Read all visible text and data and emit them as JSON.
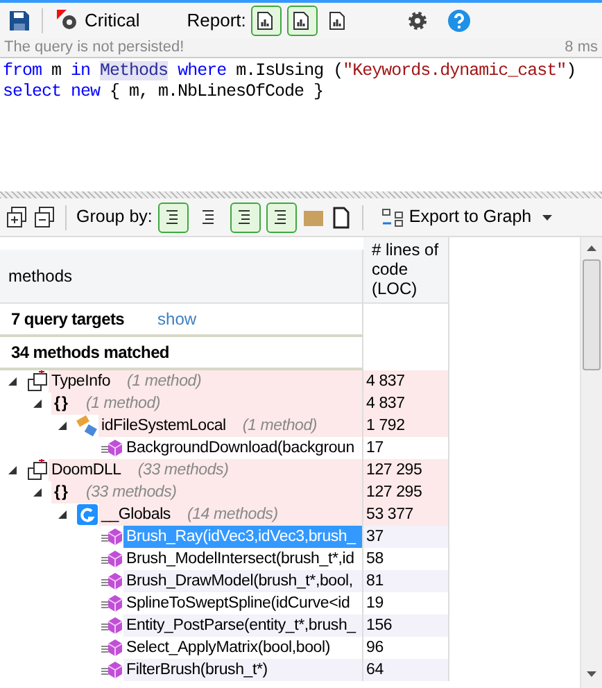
{
  "toolbar": {
    "critical_label": "Critical",
    "report_label": "Report:",
    "report_buttons": [
      {
        "selected": true
      },
      {
        "selected": true
      },
      {
        "selected": false
      }
    ]
  },
  "status": {
    "message": "The query is not persisted!",
    "time": "8 ms"
  },
  "query": [
    [
      {
        "kind": "keyword",
        "text": "from"
      },
      {
        "kind": "plain",
        "text": " m "
      },
      {
        "kind": "keyword",
        "text": "in "
      },
      {
        "kind": "highlight",
        "text": "Methods"
      },
      {
        "kind": "keyword",
        "text": " where"
      },
      {
        "kind": "plain",
        "text": " m.IsUsing ("
      },
      {
        "kind": "string",
        "text": "\"Keywords.dynamic_cast\""
      },
      {
        "kind": "plain",
        "text": ")"
      }
    ],
    [
      {
        "kind": "keyword",
        "text": "select new"
      },
      {
        "kind": "plain",
        "text": " { m, m.NbLinesOfCode }"
      }
    ]
  ],
  "results_toolbar": {
    "group_by_label": "Group by:",
    "group_buttons": [
      {
        "selected": true
      },
      {
        "selected": false
      },
      {
        "selected": true
      },
      {
        "selected": true
      }
    ],
    "export_label": "Export to Graph"
  },
  "table": {
    "columns": [
      "methods",
      "# lines of code (LOC)"
    ],
    "summary": [
      {
        "text": "7 query targets",
        "link": "show"
      },
      {
        "text": "34 methods matched"
      }
    ],
    "tree": [
      {
        "kind": "assembly",
        "name": "TypeInfo",
        "count": "(1 method)",
        "loc": "4 837",
        "expanded": true,
        "selected": false,
        "children": [
          {
            "kind": "namespace",
            "name": "{}",
            "count": "(1 method)",
            "loc": "4 837",
            "expanded": true,
            "selected": false,
            "children": [
              {
                "kind": "type",
                "name": "idFileSystemLocal",
                "count": "(1 method)",
                "loc": "1 792",
                "expanded": true,
                "selected": false,
                "children": [
                  {
                    "kind": "method",
                    "name": "BackgroundDownload(backgroun",
                    "loc": "17",
                    "selected": false
                  }
                ]
              }
            ]
          }
        ]
      },
      {
        "kind": "assembly",
        "name": "DoomDLL",
        "count": "(33 methods)",
        "loc": "127 295",
        "expanded": true,
        "selected": false,
        "children": [
          {
            "kind": "namespace",
            "name": "{}",
            "count": "(33 methods)",
            "loc": "127 295",
            "expanded": true,
            "selected": false,
            "children": [
              {
                "kind": "globals",
                "name": "__Globals",
                "count": "(14 methods)",
                "loc": "53 377",
                "expanded": true,
                "selected": false,
                "children": [
                  {
                    "kind": "method",
                    "name": "Brush_Ray(idVec3,idVec3,brush_",
                    "loc": "37",
                    "selected": true
                  },
                  {
                    "kind": "method",
                    "name": "Brush_ModelIntersect(brush_t*,id",
                    "loc": "58",
                    "selected": false
                  },
                  {
                    "kind": "method",
                    "name": "Brush_DrawModel(brush_t*,bool,",
                    "loc": "81",
                    "selected": false
                  },
                  {
                    "kind": "method",
                    "name": "SplineToSweptSpline(idCurve<id",
                    "loc": "19",
                    "selected": false
                  },
                  {
                    "kind": "method",
                    "name": "Entity_PostParse(entity_t*,brush_",
                    "loc": "156",
                    "selected": false
                  },
                  {
                    "kind": "method",
                    "name": "Select_ApplyMatrix(bool,bool)",
                    "loc": "96",
                    "selected": false
                  },
                  {
                    "kind": "method",
                    "name": "FilterBrush(brush_t*)",
                    "loc": "64",
                    "selected": false
                  }
                ]
              }
            ]
          }
        ]
      }
    ]
  }
}
